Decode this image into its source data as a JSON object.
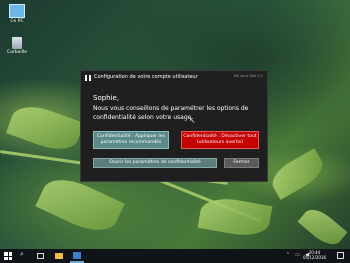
{
  "desktop": {
    "icons": [
      {
        "label": "Ce PC",
        "icon": "computer-icon"
      },
      {
        "label": "Corbeille",
        "icon": "recycle-bin-icon"
      }
    ]
  },
  "dialog": {
    "title": "Configuration de votre compte utilisateur",
    "version": "DK Asus Dell 0.1",
    "greeting": "Sophie,",
    "message": "Nous vous conseillons de paramétrer les options de confidentialité selon votre usage.",
    "buttons": {
      "recommended": "Confidentialité : Appliquer les paramètres recommandés",
      "disable": "Confidentialité : Désactiver tout (utilisateurs avertis)",
      "open_settings": "Ouvrir les paramètres de confidentialité",
      "close": "Fermer"
    }
  },
  "taskbar": {
    "time": "20:44",
    "date": "05/12/2016",
    "icons": [
      "windows-start-icon",
      "search-icon",
      "task-view-icon",
      "file-explorer-icon",
      "store-icon"
    ]
  }
}
